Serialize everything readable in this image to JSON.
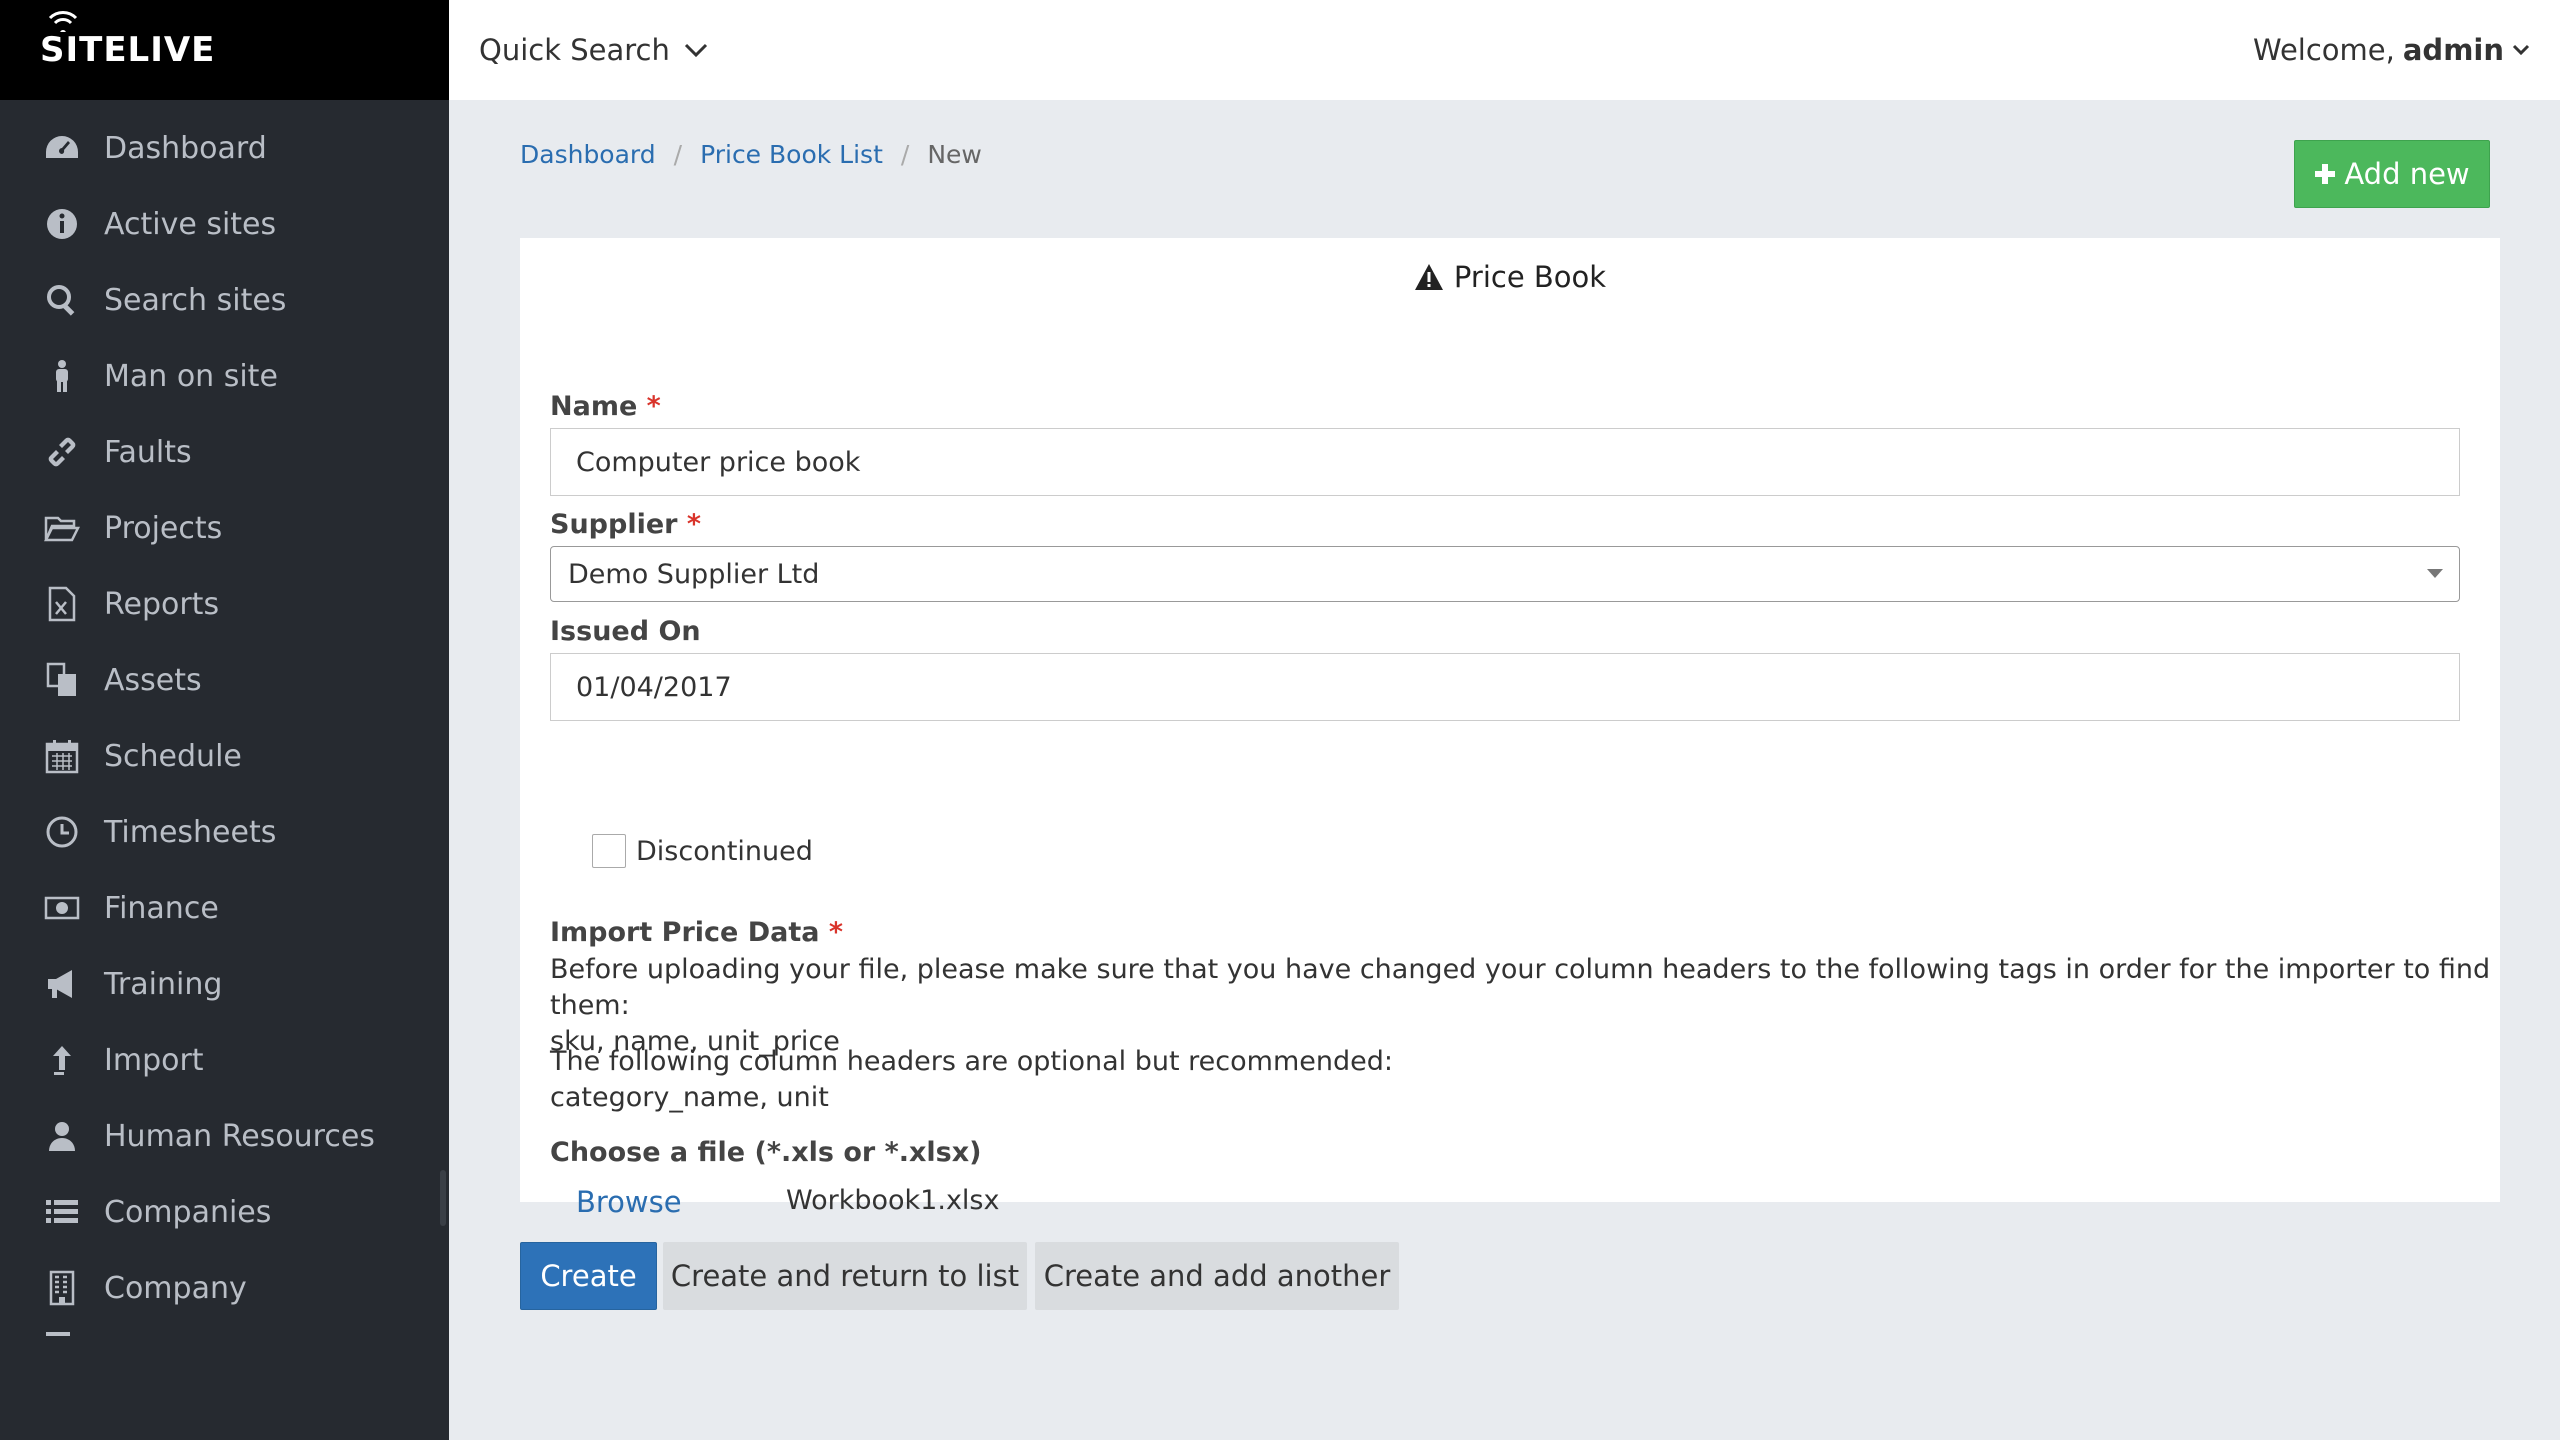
{
  "brand": {
    "name": "SITELIVE"
  },
  "sidebar": {
    "items": [
      {
        "label": "Dashboard",
        "icon": "dashboard-icon"
      },
      {
        "label": "Active sites",
        "icon": "info-circle-icon"
      },
      {
        "label": "Search sites",
        "icon": "search-icon"
      },
      {
        "label": "Man on site",
        "icon": "person-icon"
      },
      {
        "label": "Faults",
        "icon": "broken-link-icon"
      },
      {
        "label": "Projects",
        "icon": "folder-open-icon"
      },
      {
        "label": "Reports",
        "icon": "excel-file-icon"
      },
      {
        "label": "Assets",
        "icon": "copy-files-icon"
      },
      {
        "label": "Schedule",
        "icon": "calendar-icon"
      },
      {
        "label": "Timesheets",
        "icon": "clock-icon"
      },
      {
        "label": "Finance",
        "icon": "money-icon"
      },
      {
        "label": "Training",
        "icon": "megaphone-icon"
      },
      {
        "label": "Import",
        "icon": "upload-arrow-icon"
      },
      {
        "label": "Human Resources",
        "icon": "user-icon"
      },
      {
        "label": "Companies",
        "icon": "list-icon"
      },
      {
        "label": "Company",
        "icon": "building-icon"
      }
    ]
  },
  "topbar": {
    "quick_search": "Quick Search",
    "welcome_prefix": "Welcome,",
    "username": "admin"
  },
  "breadcrumb": {
    "items": [
      "Dashboard",
      "Price Book List"
    ],
    "current": "New"
  },
  "actions": {
    "add_new": "Add new"
  },
  "form": {
    "title": "Price Book",
    "name_label": "Name",
    "name_value": "Computer price book",
    "supplier_label": "Supplier",
    "supplier_value": "Demo Supplier Ltd",
    "issued_label": "Issued On",
    "issued_value": "01/04/2017",
    "discontinued_label": "Discontinued",
    "discontinued_checked": false,
    "import_label": "Import Price Data",
    "import_help_1": "Before uploading your file, please make sure that you have changed your column headers to the following tags in order for the importer to find them:",
    "import_required_cols": "sku, name, unit_price",
    "import_help_2": "The following column headers are optional but recommended:",
    "import_optional_cols": "category_name, unit",
    "file_label": "Choose a file (*.xls or *.xlsx)",
    "browse_label": "Browse",
    "file_name": "Workbook1.xlsx",
    "required_marker": "*"
  },
  "buttons": {
    "create": "Create",
    "create_return": "Create and return to list",
    "create_another": "Create and add another"
  },
  "colors": {
    "sidebar_bg": "#262a30",
    "brand_bg": "#000000",
    "link": "#2a6db0",
    "success": "#4cb85c",
    "primary": "#2d72b8",
    "required": "#d9342b"
  }
}
